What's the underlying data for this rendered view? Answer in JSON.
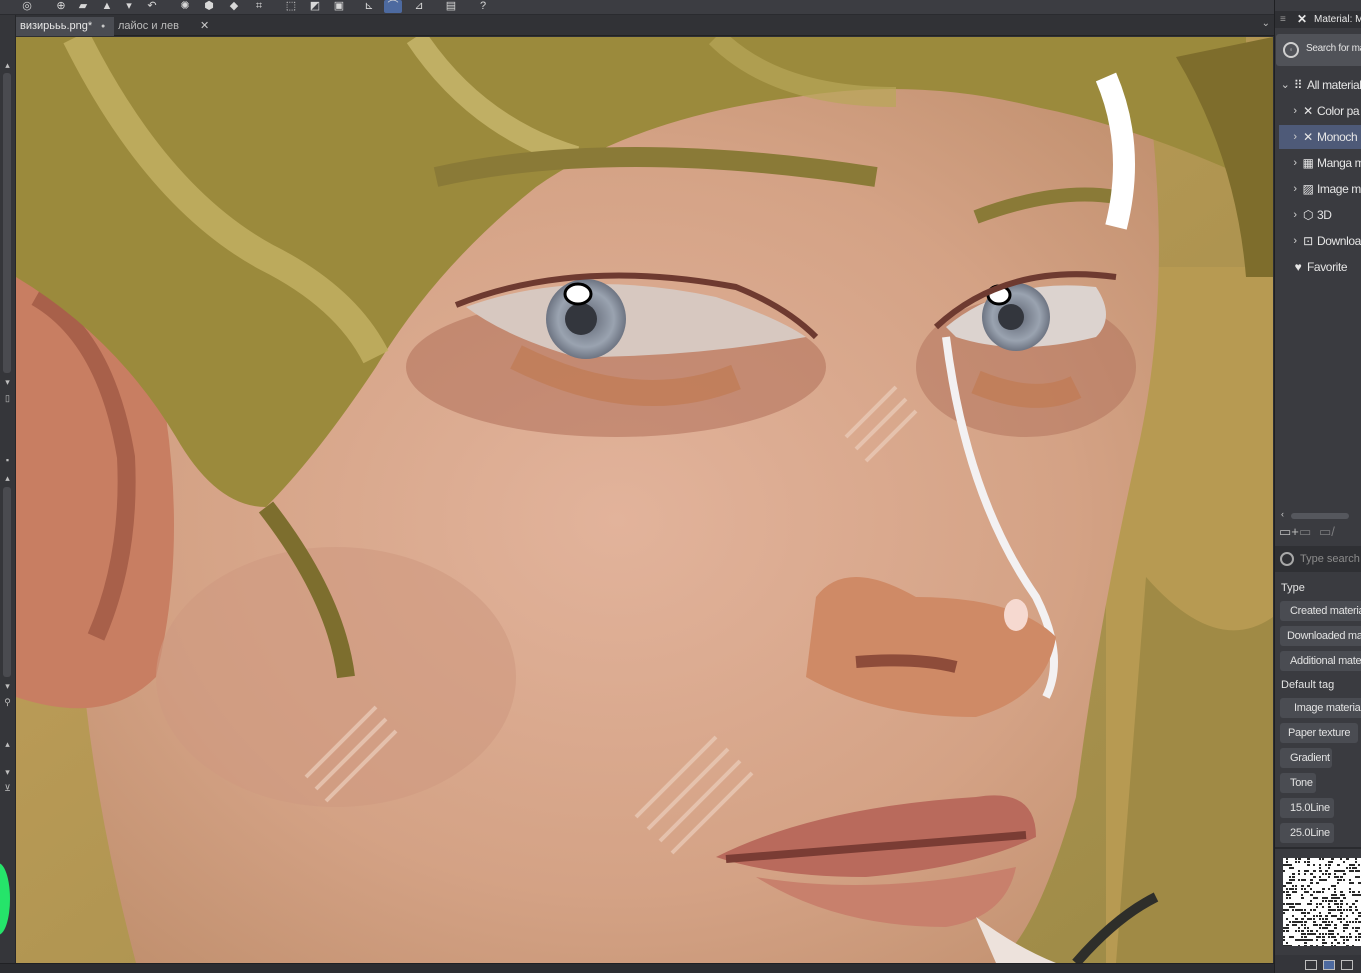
{
  "toolbar": {
    "buttons": [
      {
        "name": "app-menu-icon",
        "glyph": "◎",
        "active": false
      },
      {
        "name": "new-file-icon",
        "glyph": "⊕",
        "active": false
      },
      {
        "name": "open-folder-icon",
        "glyph": "▰",
        "active": false
      },
      {
        "name": "export-icon",
        "glyph": "▲",
        "active": false
      },
      {
        "name": "dropdown-icon",
        "glyph": "▾",
        "active": false
      },
      {
        "name": "undo-icon",
        "glyph": "↶",
        "active": false
      },
      {
        "name": "spinner-icon",
        "glyph": "✺",
        "active": false
      },
      {
        "name": "fill-icon",
        "glyph": "⬢",
        "active": false
      },
      {
        "name": "eraser-icon",
        "glyph": "◆",
        "active": false
      },
      {
        "name": "transform-icon",
        "glyph": "⌗",
        "active": false
      },
      {
        "name": "selection-icon",
        "glyph": "⬚",
        "active": false
      },
      {
        "name": "invert-icon",
        "glyph": "◩",
        "active": false
      },
      {
        "name": "crop-icon",
        "glyph": "▣",
        "active": false
      },
      {
        "name": "snap-ruler-icon",
        "glyph": "⊾",
        "active": false
      },
      {
        "name": "snap-curve-icon",
        "glyph": "⌒",
        "active": true
      },
      {
        "name": "snap-grid-icon",
        "glyph": "⊿",
        "active": false
      },
      {
        "name": "device-icon",
        "glyph": "▤",
        "active": false
      },
      {
        "name": "help-icon",
        "glyph": "?",
        "active": false
      }
    ]
  },
  "tabs": [
    {
      "label": "визирььь.png*",
      "modified_icon": "●",
      "active": true
    },
    {
      "label": "лайос и лев",
      "close_icon": "✕",
      "active": false
    }
  ],
  "tabs_chevron": "⌄",
  "panel": {
    "menu_icon": "≡",
    "close_icon": "✕",
    "title": "Material: M",
    "search_label": "Search for mate",
    "tree": [
      {
        "chevron": "⌄",
        "icon": "⠿",
        "label": "All material",
        "selected": false,
        "indent": 0
      },
      {
        "chevron": "›",
        "icon": "✕",
        "label": "Color pa",
        "selected": false,
        "indent": 1
      },
      {
        "chevron": "›",
        "icon": "✕",
        "label": "Monoch",
        "selected": true,
        "indent": 1
      },
      {
        "chevron": "›",
        "icon": "▦",
        "label": "Manga m",
        "selected": false,
        "indent": 1
      },
      {
        "chevron": "›",
        "icon": "▨",
        "label": "Image m",
        "selected": false,
        "indent": 1
      },
      {
        "chevron": "›",
        "icon": "⬡",
        "label": "3D",
        "selected": false,
        "indent": 1
      },
      {
        "chevron": "›",
        "icon": "⊡",
        "label": "Downloa",
        "selected": false,
        "indent": 1
      },
      {
        "chevron": "",
        "icon": "♥",
        "label": "Favorite",
        "selected": false,
        "indent": 0
      }
    ],
    "tools": [
      "▭+",
      "▭",
      "▭/"
    ],
    "search2_placeholder": "Type search",
    "type_label": "Type",
    "type_buttons": [
      "Created materia",
      "Downloaded ma",
      "Additional mate"
    ],
    "default_tag_label": "Default tag",
    "tag_buttons": [
      "Image materia",
      "Paper texture",
      "Gradient",
      "Tone",
      "15.0Line",
      "25.0Line"
    ]
  },
  "colors": {
    "accent": "#4d6aa0",
    "selected_row": "#4e5a78",
    "green_knob": "#25e46a",
    "panel_bg": "#3a3b40"
  }
}
